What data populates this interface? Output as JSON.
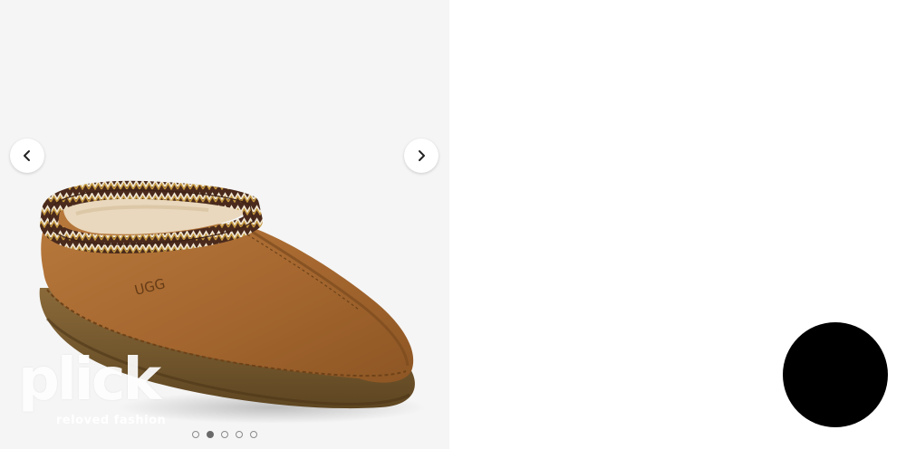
{
  "gallery": {
    "prev_icon": "chevron-left-icon",
    "next_icon": "chevron-right-icon",
    "slide_count": 5,
    "active_slide": 2,
    "product_logo_text": "UGG"
  },
  "watermark": {
    "brand": "plick",
    "tagline": "reloved fashion"
  },
  "colors": {
    "gallery_bg": "#f5f5f5",
    "suede": "#a86b34",
    "sole": "#7a5a2e",
    "circle": "#000000"
  }
}
